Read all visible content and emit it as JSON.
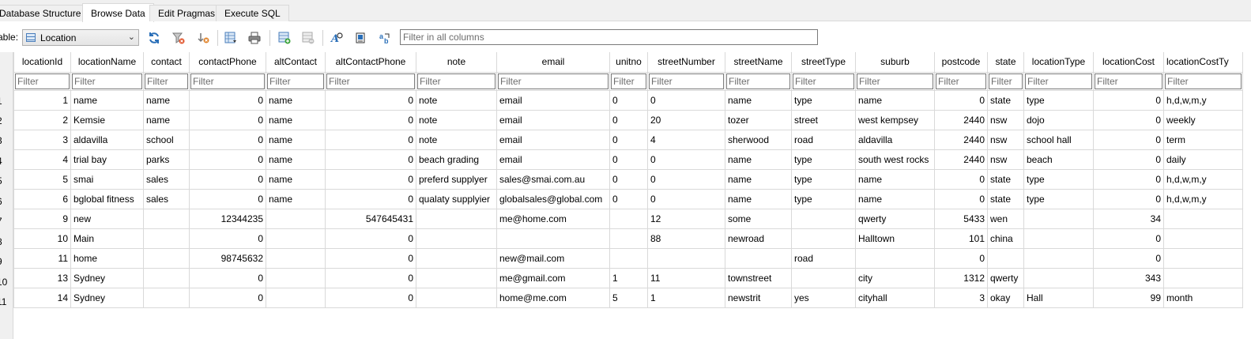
{
  "tabs": [
    {
      "label": "Database Structure",
      "active": false
    },
    {
      "label": "Browse Data",
      "active": true
    },
    {
      "label": "Edit Pragmas",
      "active": false
    },
    {
      "label": "Execute SQL",
      "active": false
    }
  ],
  "toolbar": {
    "table_label": "able:",
    "table_selected": "Location",
    "filter_all_placeholder": "Filter in all columns",
    "icons": [
      "refresh-icon",
      "clear-filters-icon",
      "clear-sorting-icon",
      "save-table-icon",
      "print-icon",
      "insert-record-icon",
      "delete-record-icon",
      "find-icon",
      "find-replace-icon",
      "text-format-icon"
    ]
  },
  "grid": {
    "filter_placeholder": "Filter",
    "columns": [
      "locationId",
      "locationName",
      "contact",
      "contactPhone",
      "altContact",
      "altContactPhone",
      "note",
      "email",
      "unitno",
      "streetNumber",
      "streetName",
      "streetType",
      "suburb",
      "postcode",
      "state",
      "locationType",
      "locationCost",
      "locationCostTy"
    ],
    "row_numbers": [
      "1",
      "2",
      "3",
      "4",
      "5",
      "6",
      "7",
      "8",
      "9",
      "10",
      "11"
    ],
    "rows": [
      [
        "1",
        "name",
        "name",
        "0",
        "name",
        "0",
        "note",
        "email",
        "0",
        "0",
        "name",
        "type",
        "name",
        "0",
        "state",
        "type",
        "0",
        "h,d,w,m,y"
      ],
      [
        "2",
        "Kemsie",
        "name",
        "0",
        "name",
        "0",
        "note",
        "email",
        "0",
        "20",
        "tozer",
        "street",
        "west kempsey",
        "2440",
        "nsw",
        "dojo",
        "0",
        "weekly"
      ],
      [
        "3",
        "aldavilla",
        "school",
        "0",
        "name",
        "0",
        "note",
        "email",
        "0",
        "4",
        "sherwood",
        "road",
        "aldavilla",
        "2440",
        "nsw",
        "school hall",
        "0",
        "term"
      ],
      [
        "4",
        "trial bay",
        "parks",
        "0",
        "name",
        "0",
        "beach grading",
        "email",
        "0",
        "0",
        "name",
        "type",
        "south west rocks",
        "2440",
        "nsw",
        "beach",
        "0",
        "daily"
      ],
      [
        "5",
        "smai",
        "sales",
        "0",
        "name",
        "0",
        "preferd supplyer",
        "sales@smai.com.au",
        "0",
        "0",
        "name",
        "type",
        "name",
        "0",
        "state",
        "type",
        "0",
        "h,d,w,m,y"
      ],
      [
        "6",
        "bglobal fitness",
        "sales",
        "0",
        "name",
        "0",
        "qualaty supplyier",
        "globalsales@global.com",
        "0",
        "0",
        "name",
        "type",
        "name",
        "0",
        "state",
        "type",
        "0",
        "h,d,w,m,y"
      ],
      [
        "9",
        "new",
        "",
        "12344235",
        "",
        "547645431",
        "",
        "me@home.com",
        "",
        "12",
        "some",
        "",
        "qwerty",
        "5433",
        "wen",
        "",
        "34",
        ""
      ],
      [
        "10",
        "Main",
        "",
        "0",
        "",
        "0",
        "",
        "",
        "",
        "88",
        "newroad",
        "",
        "Halltown",
        "101",
        "china",
        "",
        "0",
        ""
      ],
      [
        "11",
        "home",
        "",
        "98745632",
        "",
        "0",
        "",
        "new@mail.com",
        "",
        "",
        "",
        "road",
        "",
        "0",
        "",
        "",
        "0",
        ""
      ],
      [
        "13",
        "Sydney",
        "",
        "0",
        "",
        "0",
        "",
        "me@gmail.com",
        "1",
        "11",
        "townstreet",
        "",
        "city",
        "1312",
        "qwerty",
        "",
        "343",
        ""
      ],
      [
        "14",
        "Sydney",
        "",
        "0",
        "",
        "0",
        "",
        "home@me.com",
        "5",
        "1",
        "newstrit",
        "yes",
        "cityhall",
        "3",
        "okay",
        "Hall",
        "99",
        "month"
      ]
    ]
  }
}
